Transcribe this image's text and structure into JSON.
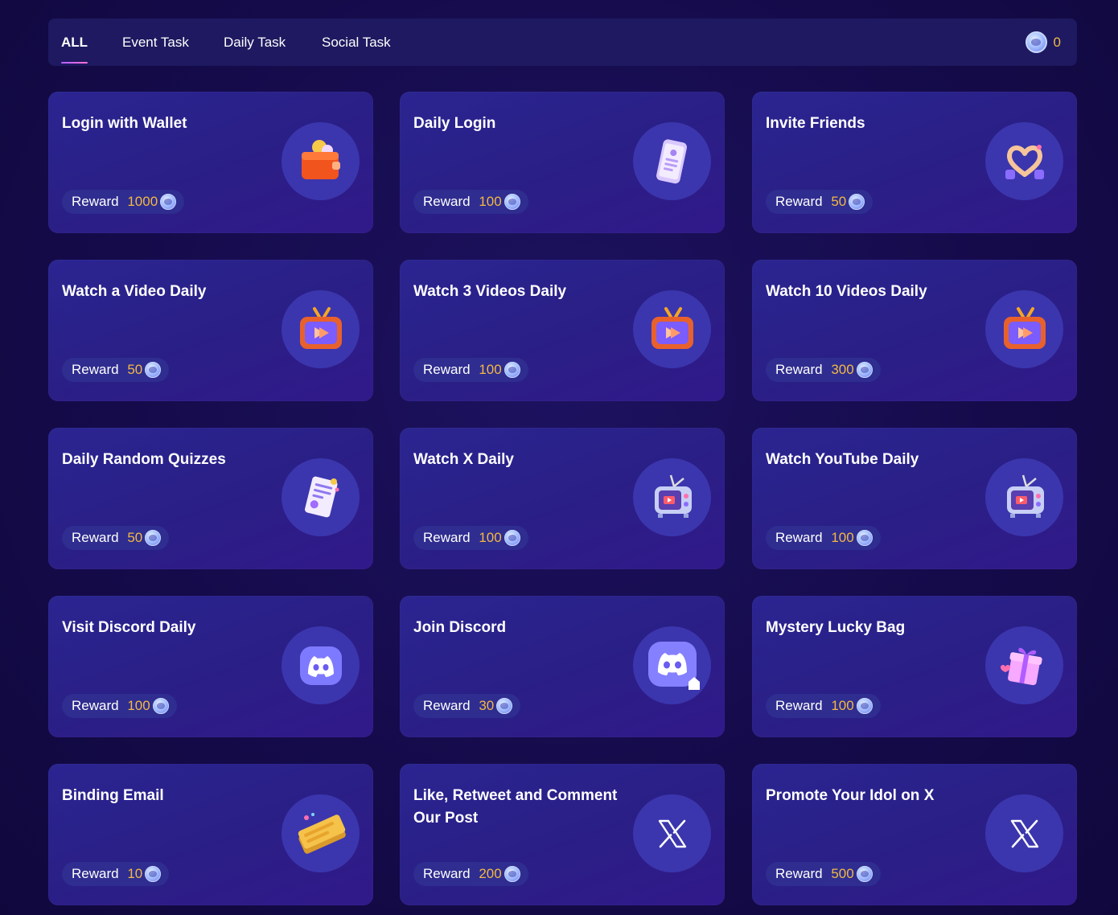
{
  "tabs": [
    {
      "label": "ALL",
      "active": true
    },
    {
      "label": "Event Task",
      "active": false
    },
    {
      "label": "Daily Task",
      "active": false
    },
    {
      "label": "Social Task",
      "active": false
    }
  ],
  "balance": {
    "value": "0",
    "icon": "coin-icon"
  },
  "reward_label": "Reward",
  "cards": [
    {
      "title": "Login with Wallet",
      "reward": "1000",
      "icon": "wallet-icon"
    },
    {
      "title": "Daily Login",
      "reward": "100",
      "icon": "phone-icon"
    },
    {
      "title": "Invite Friends",
      "reward": "50",
      "icon": "heart-hands-icon"
    },
    {
      "title": "Watch a Video Daily",
      "reward": "50",
      "icon": "tv-play-icon"
    },
    {
      "title": "Watch 3 Videos Daily",
      "reward": "100",
      "icon": "tv-play-icon"
    },
    {
      "title": "Watch 10 Videos Daily",
      "reward": "300",
      "icon": "tv-play-icon"
    },
    {
      "title": "Daily Random Quizzes",
      "reward": "50",
      "icon": "quiz-paper-icon"
    },
    {
      "title": "Watch X Daily",
      "reward": "100",
      "icon": "retro-tv-icon"
    },
    {
      "title": "Watch YouTube Daily",
      "reward": "100",
      "icon": "retro-tv-icon"
    },
    {
      "title": "Visit Discord Daily",
      "reward": "100",
      "icon": "discord-icon"
    },
    {
      "title": "Join Discord",
      "reward": "30",
      "icon": "discord-home-icon"
    },
    {
      "title": "Mystery Lucky Bag",
      "reward": "100",
      "icon": "gift-box-icon"
    },
    {
      "title": "Binding Email",
      "reward": "10",
      "icon": "ticket-icon"
    },
    {
      "title": "Like, Retweet and Comment Our Post",
      "reward": "200",
      "icon": "x-logo-icon"
    },
    {
      "title": "Promote Your Idol on X",
      "reward": "500",
      "icon": "x-logo-icon"
    }
  ]
}
